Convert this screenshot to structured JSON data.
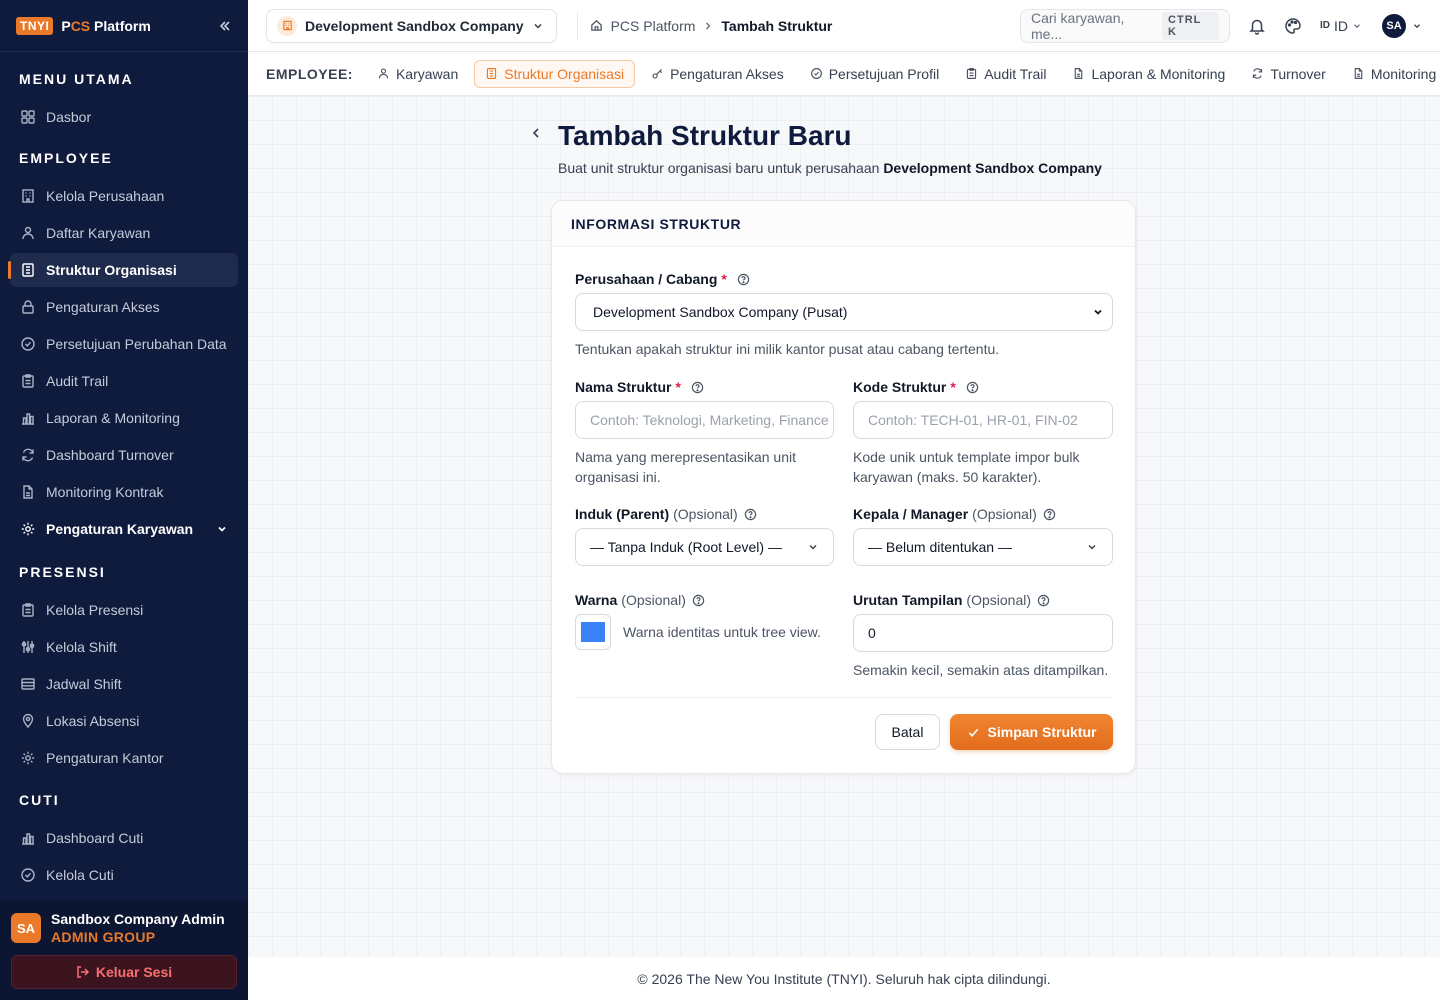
{
  "brand": {
    "badge": "TNYI",
    "name_prefix": "P",
    "name_accent": "CS",
    "name_suffix": " Platform"
  },
  "sidebar": {
    "sections": [
      {
        "title": "MENU UTAMA",
        "items": [
          {
            "label": "Dasbor",
            "icon": "grid-icon"
          }
        ]
      },
      {
        "title": "EMPLOYEE",
        "items": [
          {
            "label": "Kelola Perusahaan",
            "icon": "building-icon"
          },
          {
            "label": "Daftar Karyawan",
            "icon": "users-icon"
          },
          {
            "label": "Struktur Organisasi",
            "icon": "org-icon",
            "active": true
          },
          {
            "label": "Pengaturan Akses",
            "icon": "lock-icon"
          },
          {
            "label": "Persetujuan Perubahan Data",
            "icon": "check-circle-icon"
          },
          {
            "label": "Audit Trail",
            "icon": "clipboard-icon"
          },
          {
            "label": "Laporan & Monitoring",
            "icon": "bar-chart-icon"
          },
          {
            "label": "Dashboard Turnover",
            "icon": "refresh-icon"
          },
          {
            "label": "Monitoring Kontrak",
            "icon": "file-icon"
          },
          {
            "label": "Pengaturan Karyawan",
            "icon": "gear-icon",
            "expandable": true
          }
        ]
      },
      {
        "title": "PRESENSI",
        "items": [
          {
            "label": "Kelola Presensi",
            "icon": "clipboard-icon"
          },
          {
            "label": "Kelola Shift",
            "icon": "sliders-icon"
          },
          {
            "label": "Jadwal Shift",
            "icon": "table-icon"
          },
          {
            "label": "Lokasi Absensi",
            "icon": "map-pin-icon"
          },
          {
            "label": "Pengaturan Kantor",
            "icon": "gear-icon"
          }
        ]
      },
      {
        "title": "CUTI",
        "items": [
          {
            "label": "Dashboard Cuti",
            "icon": "bar-chart-icon"
          },
          {
            "label": "Kelola Cuti",
            "icon": "check-circle-icon"
          }
        ]
      }
    ],
    "user": {
      "initials": "SA",
      "name": "Sandbox Company Admin",
      "role": "ADMIN GROUP"
    },
    "logout_label": "Keluar Sesi"
  },
  "topbar": {
    "company": "Development Sandbox Company",
    "breadcrumb": {
      "root": "PCS Platform",
      "current": "Tambah Struktur"
    },
    "search_placeholder": "Cari karyawan, me...",
    "search_shortcut": "CTRL K",
    "lang_flag": "ID",
    "lang": "ID",
    "avatar": "SA"
  },
  "subnav": {
    "label": "EMPLOYEE:",
    "items": [
      {
        "label": "Karyawan",
        "icon": "users-icon"
      },
      {
        "label": "Struktur Organisasi",
        "icon": "org-icon",
        "active": true
      },
      {
        "label": "Pengaturan Akses",
        "icon": "key-icon"
      },
      {
        "label": "Persetujuan Profil",
        "icon": "check-circle-icon"
      },
      {
        "label": "Audit Trail",
        "icon": "clipboard-icon"
      },
      {
        "label": "Laporan & Monitoring",
        "icon": "file-icon"
      },
      {
        "label": "Turnover",
        "icon": "refresh-icon"
      },
      {
        "label": "Monitoring Kontrak",
        "icon": "file-icon"
      }
    ]
  },
  "page": {
    "title": "Tambah Struktur Baru",
    "subtitle_prefix": "Buat unit struktur organisasi baru untuk perusahaan ",
    "subtitle_company": "Development Sandbox Company"
  },
  "form": {
    "section_title": "INFORMASI STRUKTUR",
    "company": {
      "label": "Perusahaan / Cabang",
      "value": "Development Sandbox Company (Pusat)",
      "hint": "Tentukan apakah struktur ini milik kantor pusat atau cabang tertentu."
    },
    "name": {
      "label": "Nama Struktur",
      "placeholder": "Contoh: Teknologi, Marketing, Finance",
      "hint": "Nama yang merepresentasikan unit organisasi ini."
    },
    "code": {
      "label": "Kode Struktur",
      "placeholder": "Contoh: TECH-01, HR-01, FIN-02",
      "hint": "Kode unik untuk template impor bulk karyawan (maks. 50 karakter)."
    },
    "parent": {
      "label": "Induk (Parent)",
      "optional": "(Opsional)",
      "value": "— Tanpa Induk (Root Level) —"
    },
    "manager": {
      "label": "Kepala / Manager",
      "optional": "(Opsional)",
      "value": "— Belum ditentukan —"
    },
    "color": {
      "label": "Warna",
      "optional": "(Opsional)",
      "value": "#3b82f6",
      "hint": "Warna identitas untuk tree view."
    },
    "order": {
      "label": "Urutan Tampilan",
      "optional": "(Opsional)",
      "value": "0",
      "hint": "Semakin kecil, semakin atas ditampilkan."
    },
    "required_mark": "*",
    "cancel_label": "Batal",
    "save_label": "Simpan Struktur"
  },
  "footer": "© 2026 The New You Institute (TNYI). Seluruh hak cipta dilindungi.",
  "colors": {
    "accent": "#ea7a2a",
    "sidebar": "#0f1b3d",
    "danger": "#f87171"
  }
}
